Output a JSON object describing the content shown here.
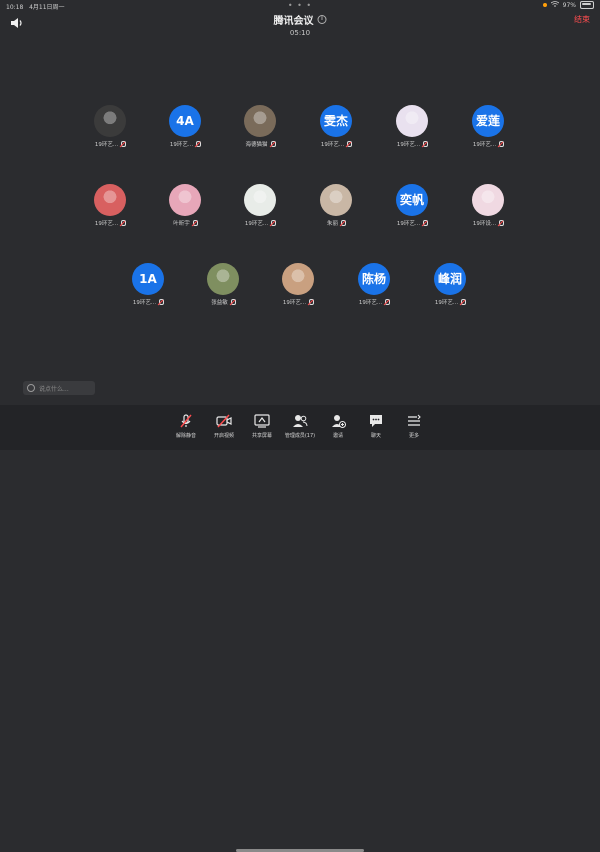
{
  "status_bar": {
    "time": "10:18",
    "date": "4月11日周一",
    "battery": "97%"
  },
  "header": {
    "dots": "• • •",
    "title": "腾讯会议",
    "timer": "05:10",
    "end_label": "结束"
  },
  "participants": [
    {
      "id": "p1",
      "name": "19环艺...",
      "avatar_text": "",
      "color": "#3b3b3b"
    },
    {
      "id": "p2",
      "name": "19环艺...",
      "avatar_text": "4A",
      "color": "#1a73e8"
    },
    {
      "id": "p3",
      "name": "海德猫猫",
      "avatar_text": "",
      "color": "#7a6b5a"
    },
    {
      "id": "p4",
      "name": "19环艺...",
      "avatar_text": "雯杰",
      "color": "#1a73e8"
    },
    {
      "id": "p5",
      "name": "19环艺...",
      "avatar_text": "",
      "color": "#e9e1ef"
    },
    {
      "id": "p6",
      "name": "19环艺...",
      "avatar_text": "爱莲",
      "color": "#1a73e8"
    },
    {
      "id": "p7",
      "name": "19环艺...",
      "avatar_text": "",
      "color": "#d86060"
    },
    {
      "id": "p8",
      "name": "叶昕宇",
      "avatar_text": "",
      "color": "#e7a7b9"
    },
    {
      "id": "p9",
      "name": "19环艺...",
      "avatar_text": "",
      "color": "#e8ece8"
    },
    {
      "id": "p10",
      "name": "朱丽",
      "avatar_text": "",
      "color": "#c9b7a5"
    },
    {
      "id": "p11",
      "name": "19环艺...",
      "avatar_text": "奕帆",
      "color": "#1a73e8"
    },
    {
      "id": "p12",
      "name": "19环设...",
      "avatar_text": "",
      "color": "#f0d9e2"
    },
    {
      "id": "p13",
      "name": "19环艺...",
      "avatar_text": "1A",
      "color": "#1a73e8"
    },
    {
      "id": "p14",
      "name": "张益敏",
      "avatar_text": "",
      "color": "#7f8f60"
    },
    {
      "id": "p15",
      "name": "19环艺...",
      "avatar_text": "",
      "color": "#c9a080"
    },
    {
      "id": "p16",
      "name": "19环艺...",
      "avatar_text": "陈杨",
      "color": "#1a73e8"
    },
    {
      "id": "p17",
      "name": "19环艺...",
      "avatar_text": "峰润",
      "color": "#1a73e8"
    }
  ],
  "chat": {
    "placeholder": "说点什么..."
  },
  "toolbar": {
    "mute_label": "解除静音",
    "video_label": "开启视频",
    "share_label": "共享屏幕",
    "members_label": "管理成员(17)",
    "invite_label": "邀请",
    "chat_label": "聊天",
    "more_label": "更多"
  },
  "colors": {
    "background": "#2b2c2f",
    "toolbar": "#232427",
    "accent_blue": "#1a73e8",
    "danger_red": "#ff4d4f"
  }
}
